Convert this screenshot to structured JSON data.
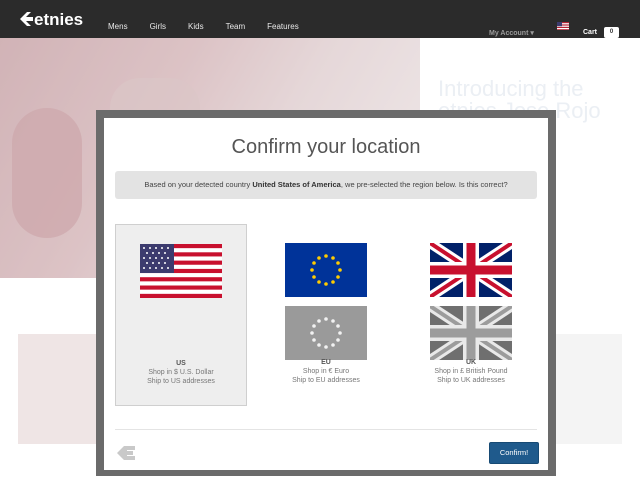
{
  "header": {
    "brand": "etnies",
    "nav": [
      "Mens",
      "Girls",
      "Kids",
      "Team",
      "Features"
    ],
    "account_label": "My Account ▾",
    "cart_label": "Cart",
    "cart_count": "0"
  },
  "background": {
    "hero_title": "Introducing the etnies Jose Rojo"
  },
  "modal": {
    "title": "Confirm your location",
    "notice_prefix": "Based on your detected country ",
    "detected_country": "United States of America",
    "notice_suffix": ", we pre-selected the region below. Is this correct?",
    "regions": [
      {
        "code": "US",
        "currency_line": "Shop in $ U.S. Dollar",
        "ship_line": "Ship to US addresses",
        "selected": true
      },
      {
        "code": "EU",
        "currency_line": "Shop in € Euro",
        "ship_line": "Ship to EU addresses",
        "selected": false
      },
      {
        "code": "UK",
        "currency_line": "Shop in £ British Pound",
        "ship_line": "Ship to UK addresses",
        "selected": false
      }
    ],
    "confirm_label": "Confirm!"
  },
  "colors": {
    "header_bg": "#2b2b2b",
    "confirm_bg": "#1f5a8c",
    "modal_frame": "#6b6b6b",
    "notice_bg": "#e3e3e3"
  },
  "icons": [
    "etnies-logo",
    "us-flag-icon",
    "eu-flag-icon",
    "uk-flag-icon",
    "etnies-e-icon"
  ]
}
